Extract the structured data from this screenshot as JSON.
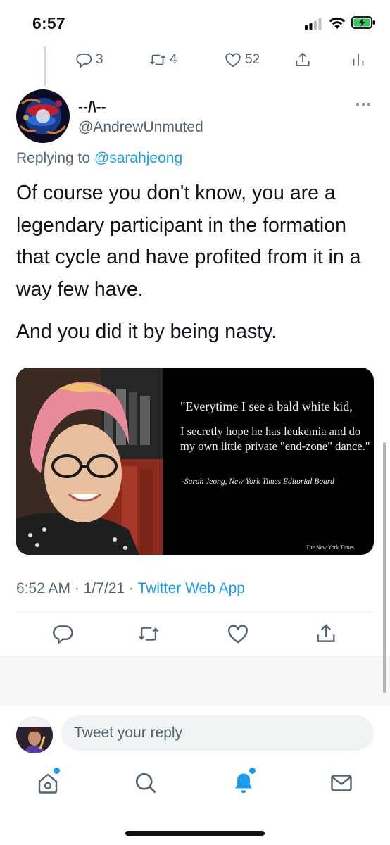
{
  "status_bar": {
    "time": "6:57"
  },
  "previous_tweet": {
    "replies_count": "3",
    "retweets_count": "4",
    "likes_count": "52"
  },
  "tweet": {
    "display_name": "--/\\--",
    "handle": "@AndrewUnmuted",
    "replying_prefix": "Replying to",
    "replying_to": "@sarahjeong",
    "paragraphs": [
      "Of course you don't know, you are a legendary participant in the formation that cycle and have profited from it in a way few have.",
      "And you did it by being nasty."
    ],
    "media": {
      "quote_line1": "\"Everytime I see a bald white kid,",
      "quote_line2": "I secretly hope he has leukemia and do my own little private \"end-zone\" dance.\"",
      "attribution": "-Sarah Jeong, New York Times Editorial Board",
      "watermark": "The New York Times"
    },
    "time": "6:52 AM",
    "date": "1/7/21",
    "source": "Twitter Web App",
    "separator": "·"
  },
  "reply_bar": {
    "placeholder": "Tweet your reply"
  },
  "colors": {
    "accent": "#1d9bf0",
    "muted": "#536471",
    "text": "#0f1419"
  }
}
